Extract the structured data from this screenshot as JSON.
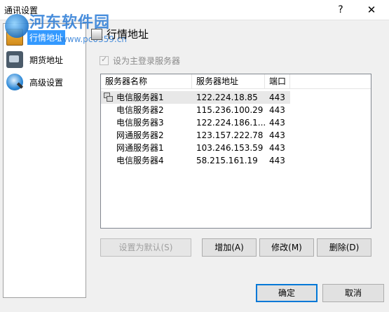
{
  "window": {
    "title": "通讯设置",
    "help_glyph": "?",
    "close_glyph": "✕"
  },
  "watermark": {
    "text": "河东软件园",
    "url": "www.pc0359.cn"
  },
  "sidebar": {
    "items": [
      {
        "label": "行情地址",
        "icon": "market-address-icon",
        "active": true
      },
      {
        "label": "期货地址",
        "icon": "futures-server-icon",
        "active": false
      },
      {
        "label": "高级设置",
        "icon": "advanced-settings-icon",
        "active": false
      }
    ]
  },
  "panel": {
    "title": "行情地址",
    "main_server_checkbox": {
      "label": "设为主登录服务器",
      "checked": true,
      "enabled": false
    }
  },
  "server_list": {
    "columns": [
      "服务器名称",
      "服务器地址",
      "端口"
    ],
    "rows": [
      {
        "name": "电信服务器1",
        "address": "122.224.18.85",
        "port": "443",
        "selected": true
      },
      {
        "name": "电信服务器2",
        "address": "115.236.100.29",
        "port": "443"
      },
      {
        "name": "电信服务器3",
        "address": "122.224.186.1...",
        "port": "443"
      },
      {
        "name": "网通服务器2",
        "address": "123.157.222.78",
        "port": "443"
      },
      {
        "name": "网通服务器1",
        "address": "103.246.153.59",
        "port": "443"
      },
      {
        "name": "电信服务器4",
        "address": "58.215.161.19",
        "port": "443"
      }
    ]
  },
  "actions": {
    "set_default": "设置为默认(S)",
    "add": "增加(A)",
    "modify": "修改(M)",
    "delete": "删除(D)"
  },
  "footer": {
    "ok": "确定",
    "cancel": "取消"
  }
}
